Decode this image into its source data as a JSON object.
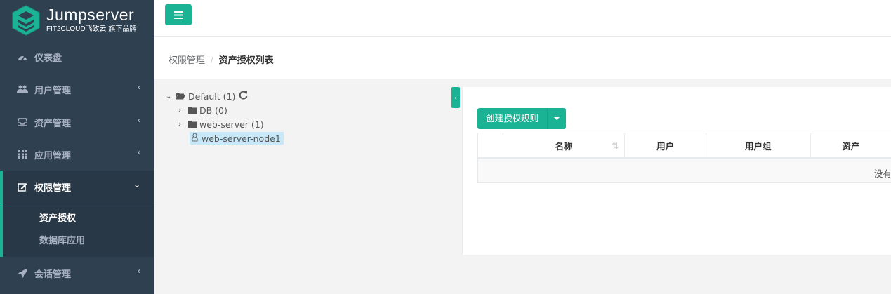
{
  "brand": {
    "title": "Jumpserver",
    "subtitle": "FIT2CLOUD飞致云 旗下品牌",
    "accent": "#1ab394",
    "sidebar_bg": "#2f4050"
  },
  "sidebar": {
    "items": [
      {
        "label": "仪表盘",
        "icon": "dashboard-icon"
      },
      {
        "label": "用户管理",
        "icon": "users-icon"
      },
      {
        "label": "资产管理",
        "icon": "inbox-icon"
      },
      {
        "label": "应用管理",
        "icon": "grid-icon"
      },
      {
        "label": "权限管理",
        "icon": "edit-icon"
      },
      {
        "label": "会话管理",
        "icon": "rocket-icon"
      }
    ],
    "submenu": [
      {
        "label": "资产授权"
      },
      {
        "label": "数据库应用"
      }
    ]
  },
  "breadcrumb": {
    "parent": "权限管理",
    "separator": "/",
    "current": "资产授权列表"
  },
  "tree": {
    "root": "Default (1)",
    "children": [
      {
        "label": "DB (0)"
      },
      {
        "label": "web-server (1)"
      },
      {
        "label": "web-server-node1"
      }
    ]
  },
  "toolbar": {
    "create_label": "创建授权规则"
  },
  "table": {
    "headers": [
      "",
      "名称",
      "用户",
      "用户组",
      "资产"
    ],
    "empty_text": "没有"
  }
}
